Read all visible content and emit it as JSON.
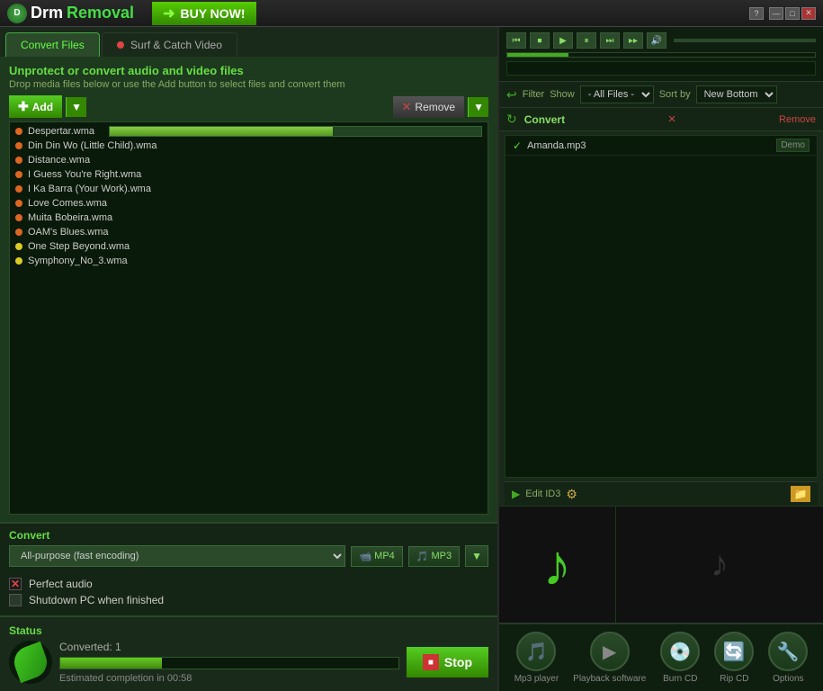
{
  "titlebar": {
    "logo_drm": "Drm",
    "logo_removal": "Removal",
    "buy_now": "BUY NOW!",
    "controls": {
      "help": "?",
      "minimize": "—",
      "maximize": "□",
      "close": "✕"
    }
  },
  "tabs": {
    "convert_files": "Convert Files",
    "surf_catch": "Surf & Catch Video"
  },
  "convert_files": {
    "heading": "Unprotect or convert audio and video files",
    "subheading": "Drop media files below or use the Add button to select files and convert them",
    "add_label": "Add",
    "remove_label": "Remove",
    "files": [
      {
        "name": "Despertar.wma",
        "dot": "orange"
      },
      {
        "name": "Din Din Wo (Little Child).wma",
        "dot": "orange"
      },
      {
        "name": "Distance.wma",
        "dot": "orange"
      },
      {
        "name": "I Guess You're Right.wma",
        "dot": "orange"
      },
      {
        "name": "I Ka Barra (Your Work).wma",
        "dot": "orange"
      },
      {
        "name": "Love Comes.wma",
        "dot": "orange"
      },
      {
        "name": "Muita Bobeira.wma",
        "dot": "orange"
      },
      {
        "name": "OAM's Blues.wma",
        "dot": "orange"
      },
      {
        "name": "One Step Beyond.wma",
        "dot": "yellow"
      },
      {
        "name": "Symphony_No_3.wma",
        "dot": "yellow"
      }
    ],
    "convert_label": "Convert",
    "format_preset": "All-purpose (fast encoding)",
    "format_mp4": "MP4",
    "format_mp3": "MP3",
    "perfect_audio": "Perfect audio",
    "shutdown": "Shutdown PC when finished",
    "status_label": "Status",
    "converted_text": "Converted: 1",
    "estimated_text": "Estimated completion in 00:58",
    "stop_label": "Stop",
    "progress_pct": 30
  },
  "player": {
    "filter_label": "Filter",
    "show_label": "Show",
    "sort_label": "Sort by",
    "filter_value": "- All Files -",
    "sort_value": "New Bottom",
    "convert_btn": "Convert",
    "remove_btn": "Remove",
    "playlist": [
      {
        "name": "Amanda.mp3",
        "badge": "Demo",
        "checked": true
      }
    ]
  },
  "edit_id3": {
    "label": "Edit ID3"
  },
  "bottom_toolbar": {
    "buttons": [
      {
        "label": "Mp3 player",
        "icon": "🎵",
        "name": "mp3-player-button"
      },
      {
        "label": "Playback software",
        "icon": "▶",
        "name": "playback-software-button"
      },
      {
        "label": "Burn CD",
        "icon": "💿",
        "name": "burn-cd-button"
      },
      {
        "label": "Rip CD",
        "icon": "🔄",
        "name": "rip-cd-button"
      },
      {
        "label": "Options",
        "icon": "🔧",
        "name": "options-button"
      }
    ]
  }
}
